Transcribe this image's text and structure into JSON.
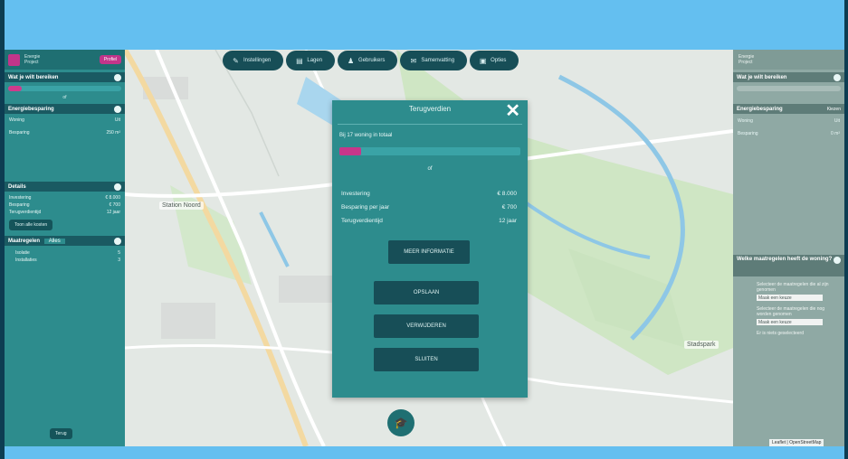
{
  "top_nav": [
    {
      "label": "Instellingen",
      "icon": "pencil-icon"
    },
    {
      "label": "Lagen",
      "icon": "layers-icon"
    },
    {
      "label": "Gebruikers",
      "icon": "users-icon"
    },
    {
      "label": "Samenvatting",
      "icon": "chat-icon"
    },
    {
      "label": "Opties",
      "icon": "box-icon"
    }
  ],
  "left_panel": {
    "header": {
      "line1": "Energie",
      "line2": "Project",
      "badge": "Profiel"
    },
    "sec1": {
      "title": "Wat je wilt bereiken"
    },
    "sec1_small": "of",
    "sec2": {
      "title": "Energiebesparing"
    },
    "sec2_rows": [
      {
        "k": "Woning",
        "v": "Uit"
      },
      {
        "k": "Besparing",
        "v": "250 m²"
      }
    ],
    "sec3": {
      "title": "Details"
    },
    "sec3_rows": [
      {
        "k": "Investering",
        "v": "€ 8.000"
      },
      {
        "k": "Besparing",
        "v": "€ 700"
      },
      {
        "k": "Terugverdientijd",
        "v": "12 jaar"
      }
    ],
    "sec3_button": "Toon alle kosten",
    "sec4": {
      "title": "Maatregelen",
      "value": "Alles"
    },
    "sec4_rows": [
      {
        "k": "Isolatie",
        "v": "5"
      },
      {
        "k": "Installaties",
        "v": "3"
      }
    ],
    "footer_button": "Terug"
  },
  "right_panel": {
    "header": {
      "line1": "Energie",
      "line2": "Project"
    },
    "sec1": {
      "title": "Wat je wilt bereiken"
    },
    "sec2": {
      "title": "Energiebesparing",
      "select": "Kiezen"
    },
    "sec2_rows": [
      {
        "k": "Woning",
        "v": "Uit"
      },
      {
        "k": "Besparing",
        "v": "0 m²"
      }
    ],
    "sec3": {
      "title": "Welke maatregelen heeft de woning?"
    },
    "notes": [
      "Selecteer de maatregelen die al zijn genomen",
      "Selecteer de maatregelen die nog worden genomen",
      "Er is niets geselecteerd"
    ],
    "selects": [
      "Maak een keuze",
      "Maak een keuze"
    ]
  },
  "modal": {
    "title": "Terugverdien",
    "subtitle": "Bij 17 woning in totaal",
    "bar_fraction": 0.12,
    "or_label": "of",
    "rows": [
      {
        "k": "Investering",
        "v": "€ 8.000"
      },
      {
        "k": "Besparing per jaar",
        "v": "€ 700"
      },
      {
        "k": "Terugverdientijd",
        "v": "12 jaar"
      }
    ],
    "more_btn": "MEER INFORMATIE",
    "buttons": [
      "OPSLAAN",
      "VERWIJDEREN",
      "SLUITEN"
    ]
  },
  "map_labels": [
    "Station Noord",
    "Stadspark"
  ],
  "watermark": "Leaflet | OpenStreetMap",
  "colors": {
    "accent": "#c2358a",
    "panel": "#2d8c8d",
    "dark": "#174e57"
  }
}
